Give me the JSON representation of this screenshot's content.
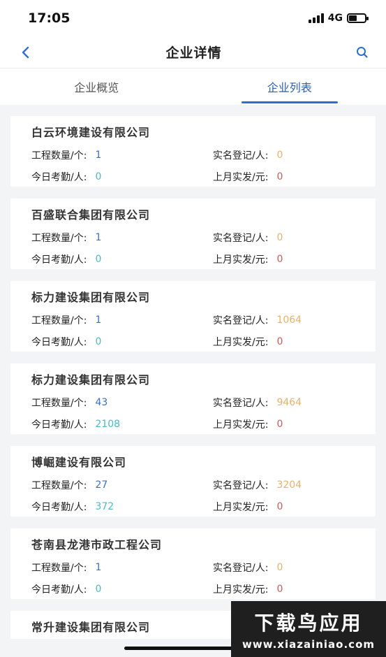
{
  "status": {
    "time": "17:05",
    "network": "4G"
  },
  "nav": {
    "title": "企业详情"
  },
  "tabs": [
    {
      "label": "企业概览",
      "active": false
    },
    {
      "label": "企业列表",
      "active": true
    }
  ],
  "labels": {
    "projects": "工程数量/个:",
    "registered": "实名登记/人:",
    "attendance": "今日考勤/人:",
    "paid": "上月实发/元:"
  },
  "companies": [
    {
      "name": "白云环境建设有限公司",
      "projects": "1",
      "registered": "0",
      "attendance": "0",
      "paid": "0"
    },
    {
      "name": "百盛联合集团有限公司",
      "projects": "1",
      "registered": "0",
      "attendance": "0",
      "paid": "0"
    },
    {
      "name": "标力建设集团有限公司",
      "projects": "1",
      "registered": "1064",
      "attendance": "0",
      "paid": "0"
    },
    {
      "name": "标力建设集团有限公司",
      "projects": "43",
      "registered": "9464",
      "attendance": "2108",
      "paid": "0"
    },
    {
      "name": "博崛建设有限公司",
      "projects": "27",
      "registered": "3204",
      "attendance": "372",
      "paid": "0"
    },
    {
      "name": "苍南县龙港市政工程公司",
      "projects": "1",
      "registered": "0",
      "attendance": "0",
      "paid": "0"
    },
    {
      "name": "常升建设集团有限公司"
    }
  ],
  "watermark": {
    "main": "下载鸟应用",
    "url": "www.xiazainiao.com"
  },
  "colors": {
    "accent": "#2b6fd0",
    "blue": "#3a6fc6",
    "orange": "#e9b06a",
    "teal": "#4bbbc7",
    "red": "#d05a5a"
  }
}
